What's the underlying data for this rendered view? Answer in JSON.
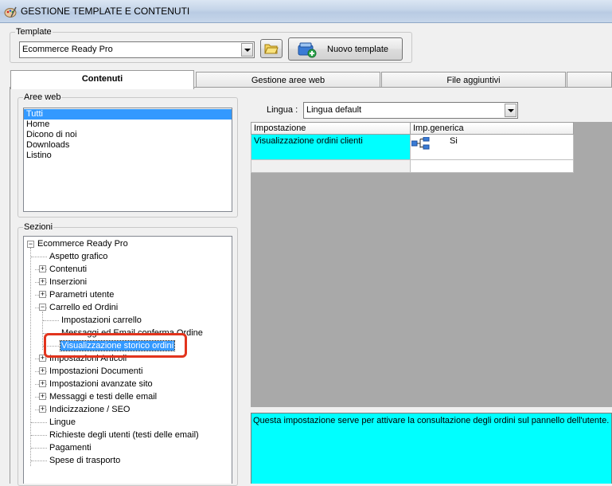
{
  "window": {
    "title": "GESTIONE TEMPLATE E CONTENUTI",
    "icon": "palette-icon"
  },
  "template_group": {
    "legend": "Template",
    "selected": "Ecommerce Ready Pro",
    "open_folder_icon": "folder-icon",
    "new_template_label": "Nuovo template",
    "new_template_icon": "add-template-icon"
  },
  "tabs": [
    {
      "label": "Contenuti",
      "active": true
    },
    {
      "label": "Gestione aree web",
      "active": false
    },
    {
      "label": "File aggiuntivi",
      "active": false
    },
    {
      "label": "",
      "active": false
    }
  ],
  "aree_web": {
    "legend": "Aree web",
    "items": [
      "Tutti",
      "Home",
      "Dicono di noi",
      "Downloads",
      "Listino"
    ],
    "selected_index": 0
  },
  "sezioni": {
    "legend": "Sezioni",
    "tree": [
      {
        "label": "Ecommerce Ready Pro",
        "level": 0,
        "expander": "minus"
      },
      {
        "label": "Aspetto grafico",
        "level": 1,
        "expander": "none"
      },
      {
        "label": "Contenuti",
        "level": 1,
        "expander": "plus"
      },
      {
        "label": "Inserzioni",
        "level": 1,
        "expander": "plus"
      },
      {
        "label": "Parametri utente",
        "level": 1,
        "expander": "plus"
      },
      {
        "label": "Carrello ed Ordini",
        "level": 1,
        "expander": "minus"
      },
      {
        "label": "Impostazioni carrello",
        "level": 2,
        "expander": "none"
      },
      {
        "label": "Messaggi ed Email conferma Ordine",
        "level": 2,
        "expander": "none"
      },
      {
        "label": "Visualizzazione storico ordini",
        "level": 2,
        "expander": "none",
        "selected": true
      },
      {
        "label": "Impostazioni Articoli",
        "level": 1,
        "expander": "plus"
      },
      {
        "label": "Impostazioni Documenti",
        "level": 1,
        "expander": "plus"
      },
      {
        "label": "Impostazioni avanzate sito",
        "level": 1,
        "expander": "plus"
      },
      {
        "label": "Messaggi e testi delle email",
        "level": 1,
        "expander": "plus"
      },
      {
        "label": "Indicizzazione / SEO",
        "level": 1,
        "expander": "plus"
      },
      {
        "label": "Lingue",
        "level": 1,
        "expander": "none"
      },
      {
        "label": "Richieste degli utenti (testi delle email)",
        "level": 1,
        "expander": "none"
      },
      {
        "label": "Pagamenti",
        "level": 1,
        "expander": "none"
      },
      {
        "label": "Spese di trasporto",
        "level": 1,
        "expander": "none"
      }
    ]
  },
  "lingua": {
    "label": "Lingua :",
    "selected": "Lingua default"
  },
  "settings_grid": {
    "columns": [
      "Impostazione",
      "Imp.generica"
    ],
    "rows": [
      {
        "setting": "Visualizzazione ordini clienti",
        "icon": "hierarchy-icon",
        "value": "Si"
      },
      {
        "setting": "",
        "icon": "",
        "value": ""
      }
    ]
  },
  "description": "Questa impostazione serve per attivare la consultazione degli ordini sul pannello dell'utente.",
  "colors": {
    "highlight": "#00ffff",
    "selection": "#3399ff",
    "annotation": "#e2341d"
  }
}
